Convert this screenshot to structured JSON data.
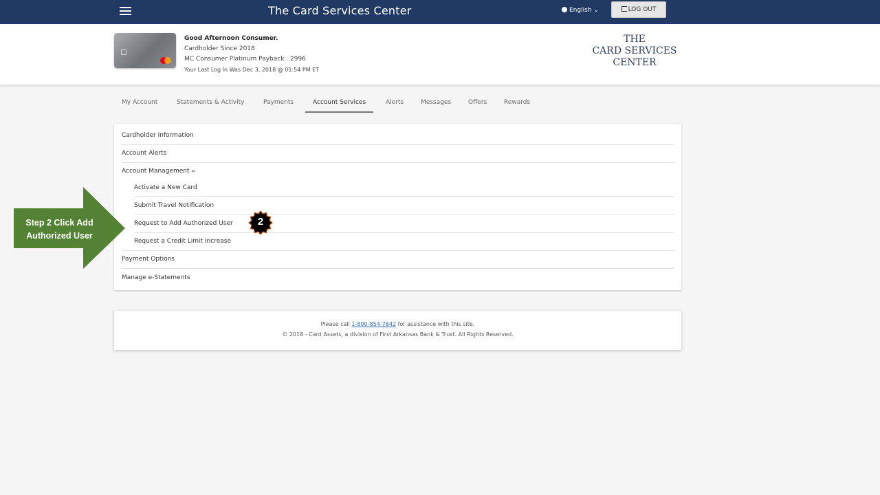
{
  "topbar": {
    "title": "The Card Services Center",
    "language": "English",
    "logout_label": "LOG OUT"
  },
  "header": {
    "greeting": "Good Afternoon Consumer.",
    "member_since": "Cardholder Since 2018",
    "account": "MC Consumer Platinum Payback...2996",
    "last_login": "Your Last Log In Was Dec 3, 2018 @ 01:54 PM ET",
    "logo_lines": [
      "THE",
      "CARD SERVICES",
      "CENTER"
    ]
  },
  "tabs": [
    "My Account",
    "Statements & Activity",
    "Payments",
    "Account Services",
    "Alerts",
    "Messages",
    "Offers",
    "Rewards"
  ],
  "active_tab": "Account Services",
  "menu": {
    "cardholder_info": "Cardholder Information",
    "account_alerts": "Account Alerts",
    "account_management": "Account Management",
    "sub_items": [
      "Activate a New Card",
      "Submit Travel Notification",
      "Request to Add Authorized User",
      "Request a Credit Limit Increase"
    ],
    "payment_options": "Payment Options",
    "manage_estatements": "Manage e-Statements"
  },
  "annotation": {
    "step_number": "2",
    "callout_line1": "Step 2 Click Add",
    "callout_line2": "Authorized User",
    "arrow_color": "#548235",
    "badge_color": "#000000",
    "badge_outline": "#c55a11"
  },
  "footer": {
    "call_prefix": "Please call ",
    "phone": "1-800-854-7642",
    "call_suffix": " for assistance with this site.",
    "copyright": "© 2018 - Card Assets, a division of First Arkansas Bank & Trust. All Rights Reserved."
  },
  "colors": {
    "topbar": "#213a63",
    "page_bg": "#f5f5f5",
    "link": "#2a67c9"
  }
}
